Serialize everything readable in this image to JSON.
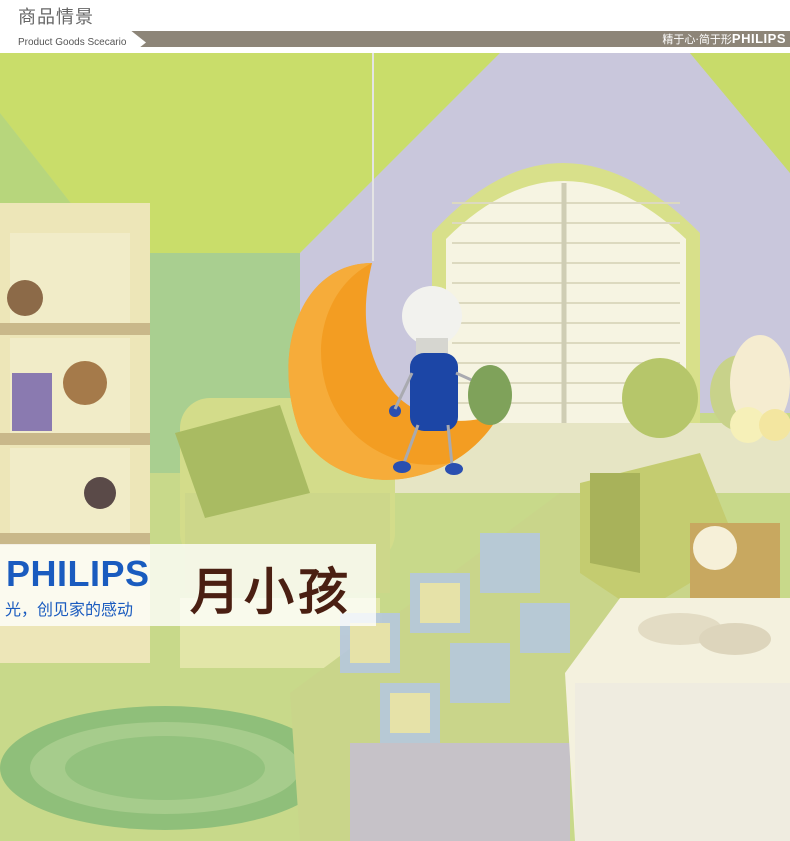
{
  "header": {
    "title": "商品情景",
    "subtitle": "Product Goods Scecario",
    "slogan": "精于心·简于形",
    "slogan_brand": "PHILIPS"
  },
  "banner": {
    "brand": "PHILIPS",
    "tagline": "光，创见家的感动",
    "product_name": "月小孩"
  },
  "colors": {
    "brand_blue": "#1a5bbf",
    "product_brown": "#4a1f12",
    "header_bar": "#8d8578"
  }
}
